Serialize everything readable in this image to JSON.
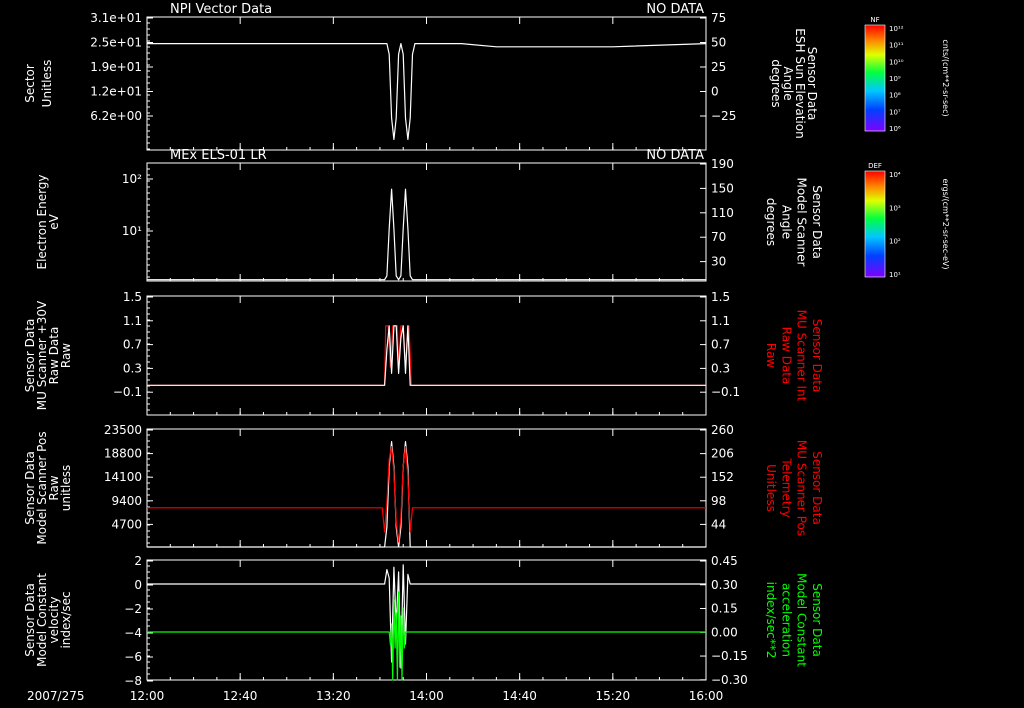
{
  "chart_data": [
    {
      "type": "line",
      "title": "NPI Vector Data",
      "status": "NO DATA",
      "ylabel": [
        "Sector",
        "Unitless"
      ],
      "y_ticks": [
        "3.1e+01",
        "2.5e+01",
        "1.9e+01",
        "1.2e+01",
        "6.2e+00"
      ],
      "ylabel_right": [
        "Sensor Data",
        "ESH Sun Elevation",
        "Angle",
        "degrees"
      ],
      "y2_ticks": [
        "75",
        "50",
        "25",
        "0",
        "−25"
      ],
      "y2lim": [
        -50,
        75
      ],
      "series": [
        {
          "color": "#ffffff",
          "axis": "right",
          "x": [
            0,
            103,
            104,
            105,
            106,
            107,
            108,
            109,
            110,
            111,
            112,
            113,
            114,
            115,
            135,
            150,
            200,
            240
          ],
          "y": [
            50,
            50,
            40,
            -20,
            -40,
            -20,
            40,
            50,
            40,
            -20,
            -40,
            -20,
            40,
            50,
            50,
            47,
            47,
            50
          ]
        }
      ]
    },
    {
      "type": "line",
      "title": "MEx ELS-01 LR",
      "status": "NO DATA",
      "ylabel": [
        "Electron Energy",
        "eV"
      ],
      "y_ticks": [
        "10²",
        "10¹"
      ],
      "ylabel_right": [
        "Sensor Data",
        "Model Scanner",
        "Angle",
        "degrees"
      ],
      "y2_ticks": [
        "190",
        "150",
        "110",
        "70",
        "30"
      ],
      "y2lim": [
        10,
        190
      ],
      "series": [
        {
          "color": "#ffffff",
          "axis": "right",
          "x": [
            0,
            102,
            103,
            104,
            105,
            106,
            107,
            108,
            109,
            110,
            111,
            112,
            113,
            114,
            240
          ],
          "y": [
            12,
            12,
            18,
            90,
            150,
            90,
            18,
            12,
            18,
            90,
            150,
            90,
            18,
            12,
            12
          ]
        }
      ]
    },
    {
      "type": "line",
      "title": "",
      "ylabel": [
        "Sensor Data",
        "MU Scanner +30V",
        "Raw Data",
        "Raw"
      ],
      "y_ticks": [
        "1.5",
        "1.1",
        "0.7",
        "0.3",
        "−0.1"
      ],
      "ylabel_right": [
        "Sensor Data",
        "MU Scanner Int",
        "Raw Data",
        "Raw"
      ],
      "ylabel_right_color": "#ff0000",
      "y2_ticks": [
        "1.5",
        "1.1",
        "0.7",
        "0.3",
        "−0.1"
      ],
      "ylim": [
        -0.5,
        1.5
      ],
      "series": [
        {
          "color": "#ff0000",
          "x": [
            0,
            102,
            102.5,
            103.5,
            104.5,
            105.5,
            106.5,
            107.5,
            108,
            109,
            110,
            111,
            112,
            112.5,
            113.5,
            240
          ],
          "y": [
            0,
            0,
            1.0,
            1.0,
            0.3,
            1.0,
            1.0,
            1.0,
            0.3,
            1.0,
            1.0,
            0.3,
            1.0,
            1.0,
            0,
            0
          ]
        },
        {
          "color": "#ffffff",
          "x": [
            0,
            102,
            103,
            104,
            105,
            106,
            107,
            108,
            109,
            110,
            111,
            112,
            113,
            240
          ],
          "y": [
            0,
            0,
            0.6,
            1.0,
            0.2,
            1.0,
            1.0,
            0.2,
            0.8,
            1.0,
            0.2,
            1.0,
            0,
            0
          ]
        }
      ]
    },
    {
      "type": "line",
      "title": "",
      "ylabel": [
        "Sensor Data",
        "Model Scanner Pos",
        "Raw",
        "unitless"
      ],
      "y_ticks": [
        "23500",
        "18800",
        "14100",
        "9400",
        "4700"
      ],
      "ylim": [
        0,
        23500
      ],
      "ylabel_right": [
        "Sensor Data",
        "MU Scanner Pos",
        "Telemetry",
        "Unitless"
      ],
      "ylabel_right_color": "#ff0000",
      "y2_ticks": [
        "260",
        "206",
        "152",
        "98",
        "44"
      ],
      "series": [
        {
          "color": "#ffffff",
          "x": [
            0,
            102,
            103,
            104,
            105,
            106,
            107,
            108,
            109,
            110,
            111,
            112,
            113,
            240
          ],
          "y": [
            0,
            0,
            4000,
            16000,
            21000,
            16000,
            4000,
            0,
            4000,
            16000,
            21000,
            16000,
            0,
            0
          ]
        },
        {
          "color": "#ff0000",
          "x": [
            0,
            101,
            102,
            103,
            104,
            105,
            106,
            107,
            108,
            109,
            110,
            111,
            112,
            113,
            114,
            240
          ],
          "y": [
            7800,
            7800,
            3000,
            9000,
            17500,
            20000,
            15000,
            5000,
            1000,
            6000,
            16000,
            20000,
            14000,
            3000,
            7800,
            7800
          ]
        }
      ]
    },
    {
      "type": "line",
      "title": "",
      "ylabel": [
        "Sensor Data",
        "Model Constant",
        "velocity",
        "index/sec"
      ],
      "y_ticks": [
        "2",
        "0",
        "−2",
        "−4",
        "−6",
        "−8"
      ],
      "ylim": [
        -8,
        2
      ],
      "ylabel_right": [
        "Sensor Data",
        "Model Constant",
        "acceleration",
        "index/sec**2"
      ],
      "ylabel_right_color": "#00ff00",
      "y2_ticks": [
        "0.45",
        "0.30",
        "0.15",
        "0.00",
        "−0.15",
        "−0.30"
      ],
      "y2lim": [
        -0.3,
        0.45
      ],
      "series": [
        {
          "color": "#ffffff",
          "x": [
            0,
            102,
            103,
            104,
            105,
            106,
            107,
            108,
            109,
            110,
            111,
            112,
            113,
            240
          ],
          "y": [
            0,
            0,
            1.2,
            0.5,
            -6.5,
            1.4,
            -3.5,
            1.0,
            -7,
            1.6,
            -5,
            0.8,
            0,
            0
          ]
        },
        {
          "color": "#00ff00",
          "axis": "right",
          "x": [
            0,
            104,
            104.5,
            105,
            105.5,
            106,
            106.5,
            107,
            107.5,
            108,
            108.5,
            109,
            109.5,
            110,
            110.5,
            111,
            240
          ],
          "y": [
            0,
            0,
            -0.08,
            0.05,
            -0.3,
            0.2,
            -0.1,
            0.12,
            -0.3,
            0.25,
            -0.22,
            0.1,
            -0.3,
            0.15,
            -0.1,
            0,
            0
          ]
        }
      ]
    }
  ],
  "x_axis": {
    "date_label": "2007/275",
    "ticks": [
      "12:00",
      "12:40",
      "13:20",
      "14:00",
      "14:40",
      "15:20",
      "16:00"
    ],
    "xlim_minutes": [
      0,
      240
    ]
  },
  "colorbars": [
    {
      "label": "NF",
      "unit": "cnts/(cm**2-sr-sec)",
      "ticks": [
        "10¹²",
        "10¹¹",
        "10¹⁰",
        "10⁹",
        "10⁸",
        "10⁷",
        "10⁶"
      ]
    },
    {
      "label": "DEF",
      "unit": "ergs/(cm**2-sr-sec-eV)",
      "ticks": [
        "10⁴",
        "10³",
        "10²",
        "10¹"
      ]
    }
  ]
}
